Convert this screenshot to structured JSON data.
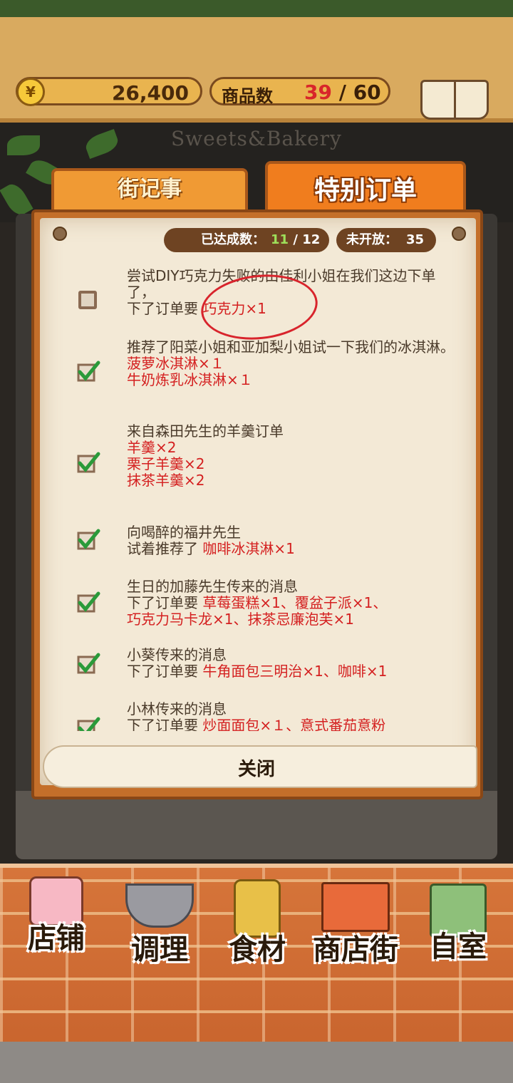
{
  "header": {
    "money": "26,400",
    "coin_symbol": "¥",
    "goods_label": "商品数",
    "goods_current": "39",
    "goods_separator": " / ",
    "goods_max": "60",
    "recipe_label": "食谱"
  },
  "shop_sign": "Sweets&Bakery",
  "tabs": [
    {
      "label": "街记事",
      "active": false
    },
    {
      "label": "特别订单",
      "active": true
    }
  ],
  "stats": {
    "achieved_label": "已达成数：",
    "achieved": "11",
    "achieved_sep": "/",
    "achieved_total": "12",
    "unopened_label": "未开放：",
    "unopened": "35"
  },
  "orders": [
    {
      "done": false,
      "lines": [
        "尝试DIY巧克力失败的由佳利小姐在我们这边下单了，"
      ],
      "prefix": "下了订单要",
      "items": [
        "巧克力×1"
      ]
    },
    {
      "done": true,
      "lines": [
        "推荐了阳菜小姐和亚加梨小姐试一下我们的冰淇淋。"
      ],
      "prefix": "",
      "items": [
        "菠萝冰淇淋×１",
        "牛奶炼乳冰淇淋×１"
      ]
    },
    {
      "done": true,
      "lines": [
        "来自森田先生的羊羹订单"
      ],
      "prefix": "",
      "items": [
        "羊羹×2",
        "栗子羊羹×2",
        "抹茶羊羹×2"
      ]
    },
    {
      "done": true,
      "lines": [
        "向喝醉的福井先生"
      ],
      "prefix": "试着推荐了",
      "items": [
        "咖啡冰淇淋×1"
      ]
    },
    {
      "done": true,
      "lines": [
        "生日的加藤先生传来的消息"
      ],
      "prefix": "下了订单要",
      "items": [
        "草莓蛋糕×1、覆盆子派×1、",
        "巧克力马卡龙×1、抹茶忌廉泡芙×1"
      ]
    },
    {
      "done": true,
      "lines": [
        "小葵传来的消息"
      ],
      "prefix": "下了订单要",
      "items": [
        "牛角面包三明治×1、咖啡×1"
      ]
    },
    {
      "done": true,
      "lines": [
        "小林传来的消息"
      ],
      "prefix": "下了订单要",
      "items": [
        "炒面面包×１、意式番茄意粉"
      ]
    }
  ],
  "close_label": "关闭",
  "bottom_nav": [
    {
      "label": "店铺",
      "icon": "cake-icon"
    },
    {
      "label": "调理",
      "icon": "mixing-bowl-icon"
    },
    {
      "label": "食材",
      "icon": "flour-bag-icon"
    },
    {
      "label": "商店街",
      "icon": "storefront-icon"
    },
    {
      "label": "自室",
      "icon": "staff-only-door-icon"
    }
  ],
  "colors": {
    "accent": "#f07d1e",
    "order_item": "#d42020",
    "done_count": "#9ee05a"
  }
}
